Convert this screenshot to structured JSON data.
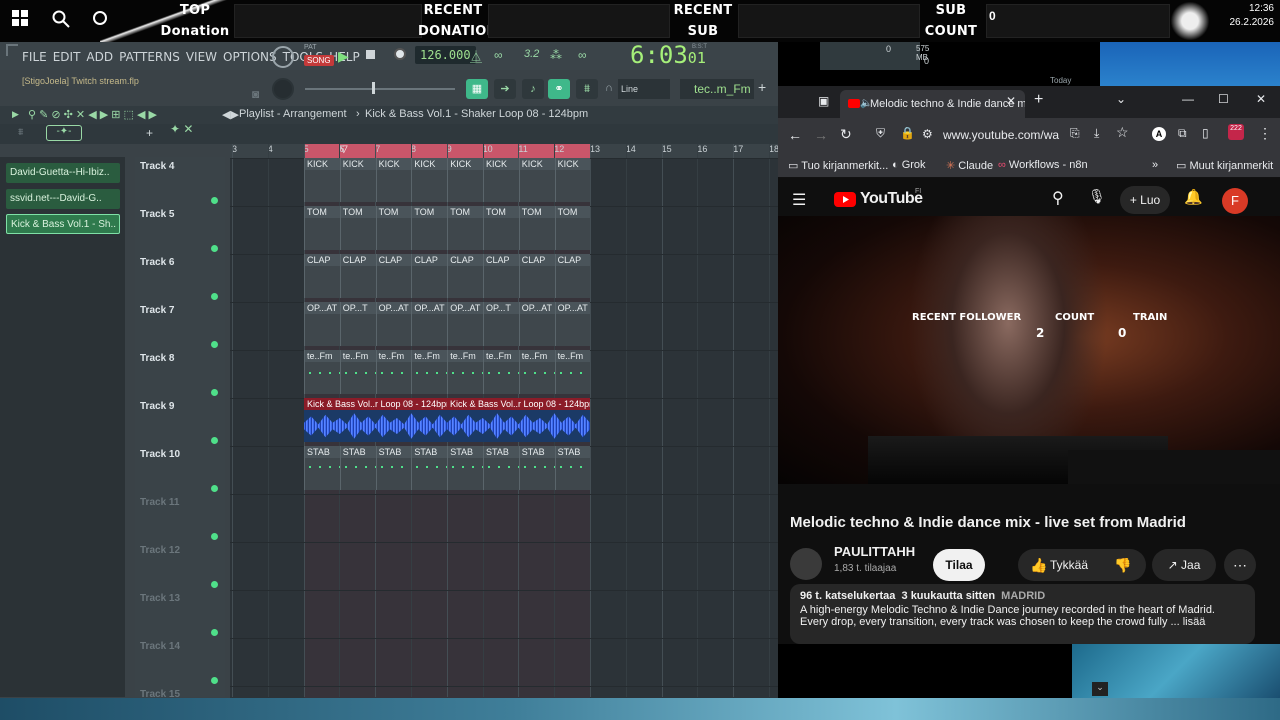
{
  "overlay": {
    "top_label": "TOP",
    "donation_label": "Donation",
    "recent_donation_1": "RECENT",
    "recent_donation_2": "DONATION",
    "recent_sub_1": "RECENT",
    "recent_sub_2": "SUB",
    "sub_count_1": "SUB",
    "sub_count_2": "COUNT",
    "sub_count_value": "0",
    "clock_time": "12:36",
    "clock_date": "26.2.2026"
  },
  "fl": {
    "menu": [
      "FILE",
      "EDIT",
      "ADD",
      "PATTERNS",
      "VIEW",
      "OPTIONS",
      "TOOLS",
      "HELP"
    ],
    "pat_label": "PAT",
    "song_label": "SONG",
    "bpm": "126.000",
    "time": "6:03",
    "time_frames": "01",
    "time_unit": "B:S:T",
    "project_hint": "[StigoJoela] Twitch stream.flp",
    "mixer_value": "0",
    "memory": "575 MB",
    "memory_sub": "0",
    "snap": "Line",
    "pattern_name": "tec..m_Fm",
    "today_label": "Today",
    "playlist_title": "Playlist - Arrangement",
    "playlist_pattern": "Kick & Bass Vol.1 - Shaker Loop 08 - 124bpm",
    "browser_items": [
      "David-Guetta--Hi-Ibiz..",
      "ssvid.net---David-G..",
      "Kick & Bass Vol.1 - Sh.."
    ],
    "tracks": [
      "Track 4",
      "Track 5",
      "Track 6",
      "Track 7",
      "Track 8",
      "Track 9",
      "Track 10",
      "Track 11",
      "Track 12",
      "Track 13",
      "Track 14",
      "Track 15"
    ],
    "ruler": [
      "3",
      "4",
      "5",
      "6",
      "7",
      "8",
      "9",
      "10",
      "11",
      "12",
      "13",
      "14",
      "15",
      "16",
      "17",
      "18"
    ],
    "clip_rows": {
      "kick": "KICK",
      "tom": "TOM",
      "clap": "CLAP",
      "op1": "OP...AT",
      "op2": "OP...T",
      "te": "te..Fm",
      "stab": "STAB"
    },
    "audio_clip_1": "Kick & Bass Vol..r Loop 08 - 124bpm",
    "audio_clip_2": "Kick & Bass Vol..r Loop 08 - 124bpm"
  },
  "browser": {
    "tab_title": "Melodic techno & Indie dance mix - live set from Madrid",
    "url": "www.youtube.com/wa",
    "ext_badge": "222",
    "bookmarks": [
      "Tuo kirjanmerkit...",
      "Grok",
      "Claude",
      "Workflows - n8n"
    ],
    "bookmarks_other": "Muut kirjanmerkit",
    "yt_logo": "YouTube",
    "yt_region": "FI",
    "create_label": "Luo",
    "avatar_letter": "F",
    "video_overlay": {
      "recent_follower": "RECENT FOLLOWER",
      "count": "COUNT",
      "train": "TRAIN",
      "follower_value": "2",
      "count_value": "0"
    },
    "video_title": "Melodic techno & Indie dance mix - live set from Madrid",
    "channel": "PAULITTAHH",
    "subscribers": "1,83 t. tilaajaa",
    "subscribe": "Tilaa",
    "like": "Tykkää",
    "share": "Jaa",
    "views": "96 t. katselukertaa",
    "age": "3 kuukautta sitten",
    "location": "MADRID",
    "description": "A high-energy Melodic Techno & Indie Dance journey recorded in the heart of Madrid.",
    "description_more": "Every drop, every transition, every track was chosen to keep the crowd fully ... lisää"
  },
  "colors": {
    "fl_green": "#4fe08a",
    "yt_red": "#ff0000",
    "audio_blue": "#2a4fc4"
  }
}
